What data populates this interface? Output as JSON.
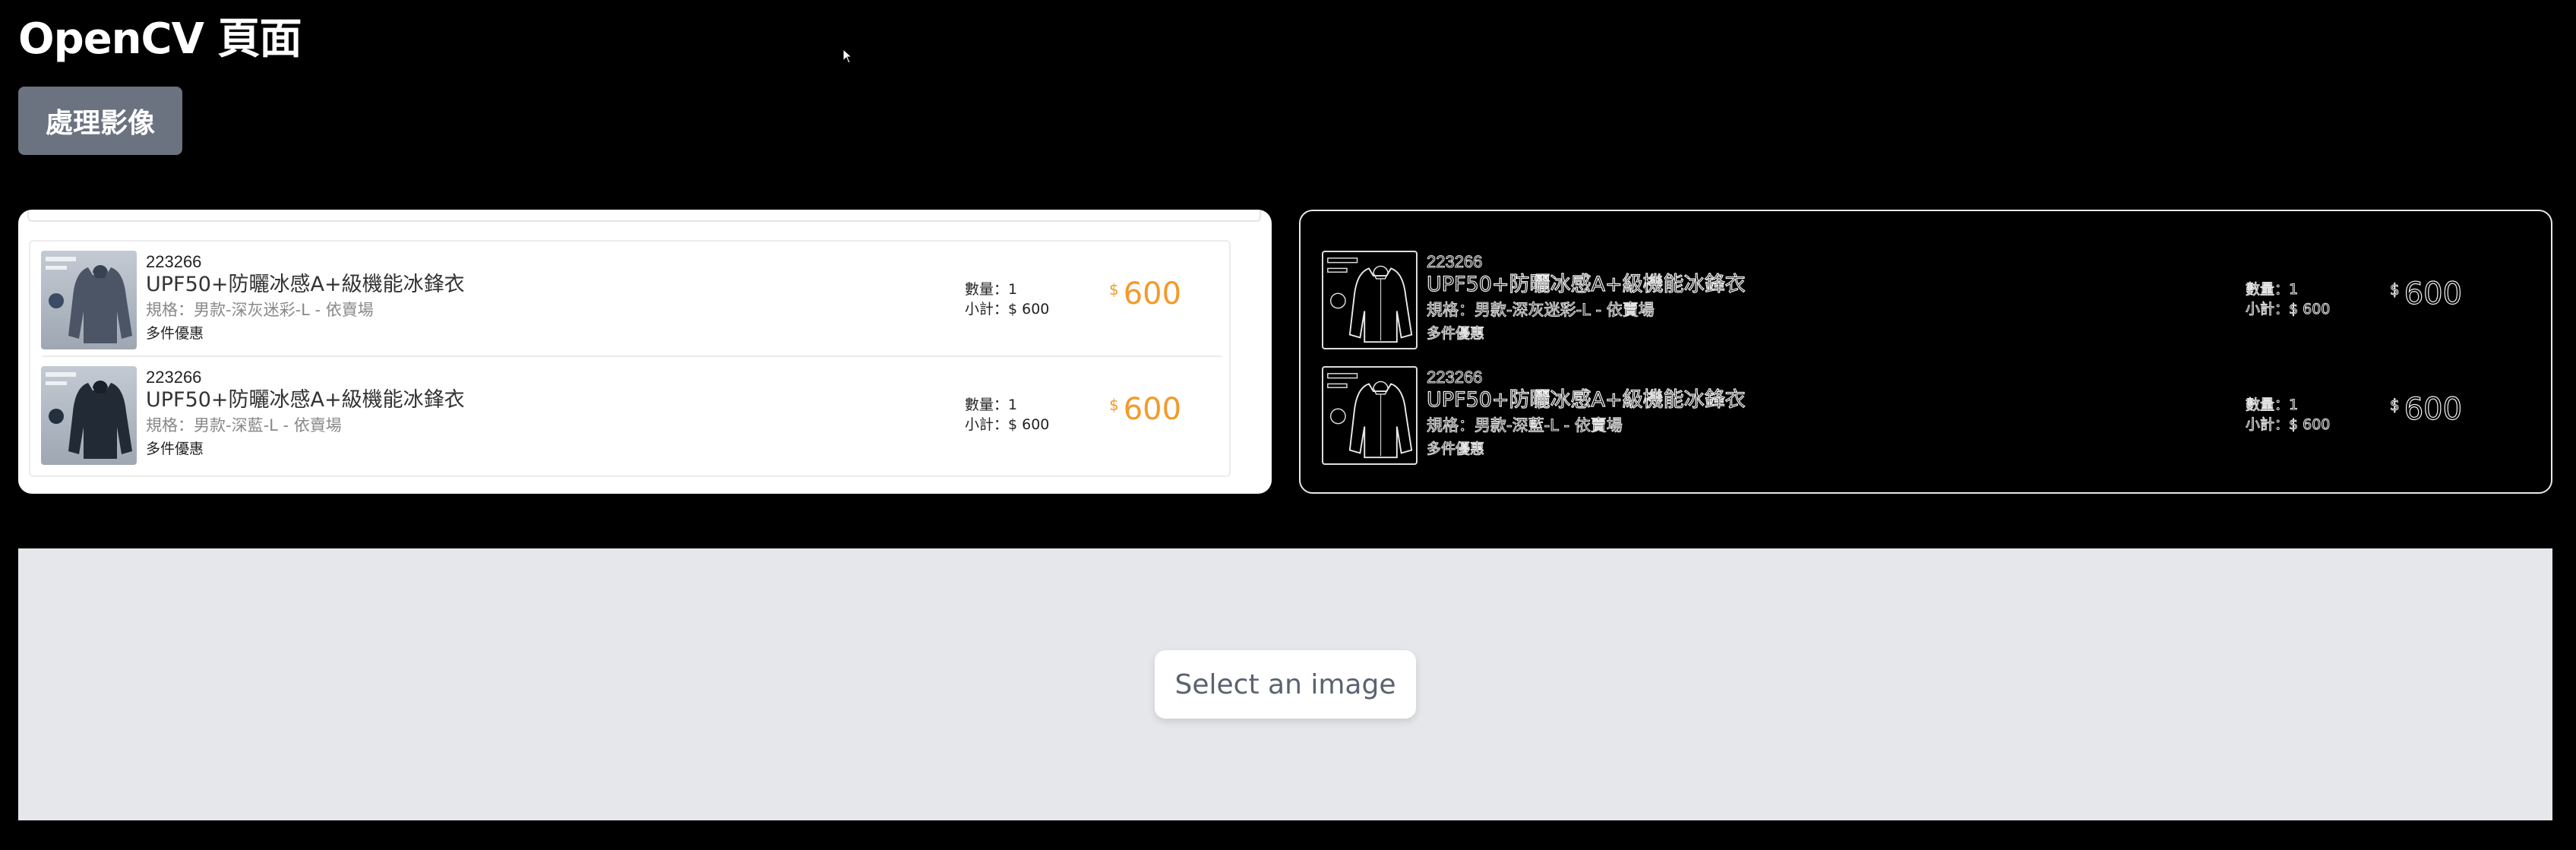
{
  "page": {
    "title": "OpenCV 頁面",
    "process_button": "處理影像"
  },
  "cart_items": [
    {
      "sku": "223266",
      "name": "UPF50+防曬冰感A+級機能冰鋒衣",
      "spec": "規格：男款-深灰迷彩-L - 依賣場",
      "promo": "多件優惠",
      "qty": "數量：1",
      "subtotal": "小計：$ 600",
      "currency": "$",
      "price": "600"
    },
    {
      "sku": "223266",
      "name": "UPF50+防曬冰感A+級機能冰鋒衣",
      "spec": "規格：男款-深藍-L - 依賣場",
      "promo": "多件優惠",
      "qty": "數量：1",
      "subtotal": "小計：$ 600",
      "currency": "$",
      "price": "600"
    }
  ],
  "upload": {
    "select_button": "Select an image"
  },
  "colors": {
    "price_accent": "#f39a2a",
    "process_button_bg": "#6b7280",
    "upload_bg": "#e5e7eb"
  }
}
